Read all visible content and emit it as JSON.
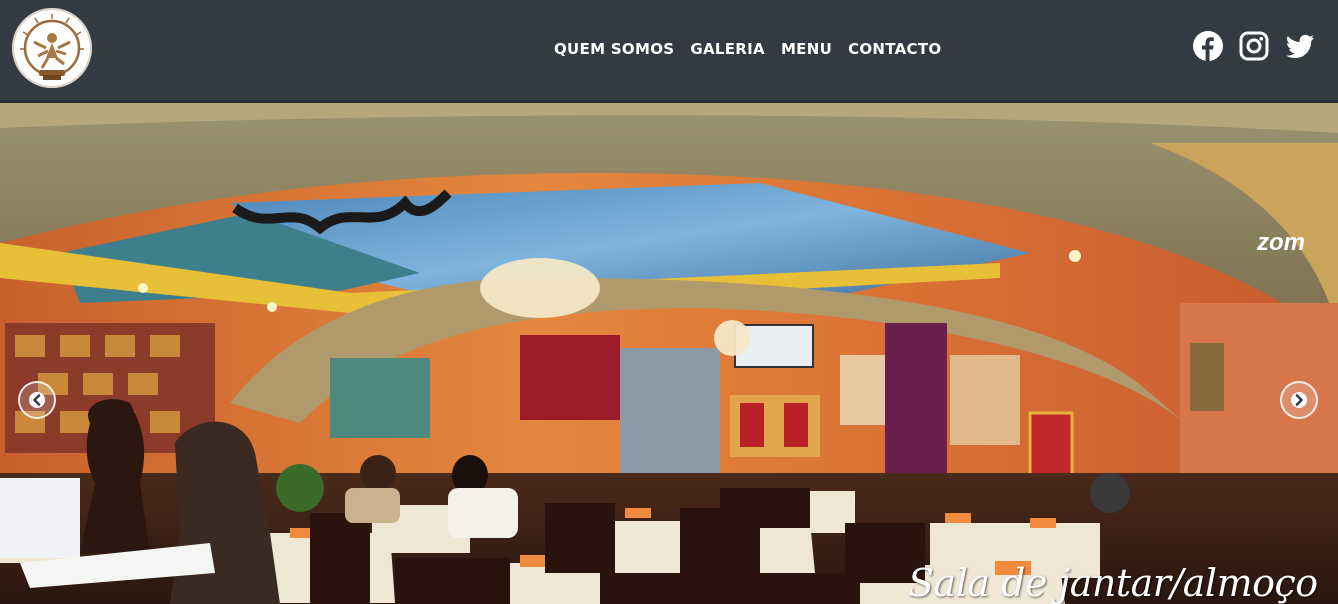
{
  "nav": {
    "items": [
      {
        "label": "QUEM SOMOS"
      },
      {
        "label": "GALERIA"
      },
      {
        "label": "MENU"
      },
      {
        "label": "CONTACTO"
      }
    ],
    "social": [
      "facebook-icon",
      "instagram-icon",
      "twitter-icon"
    ]
  },
  "hero": {
    "caption": "Sala de jantar/almoço",
    "watermark": "zom"
  },
  "colors": {
    "navbar": "#343a41",
    "text": "#ffffff"
  }
}
